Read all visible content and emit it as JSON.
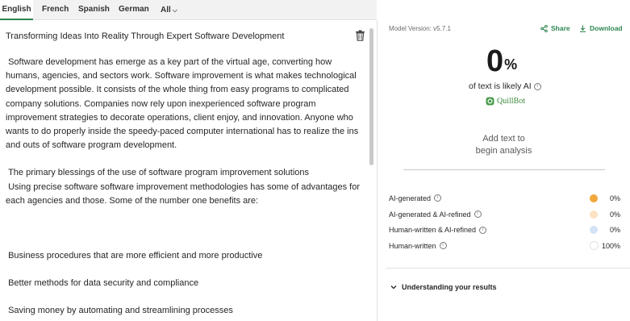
{
  "tabs": [
    "English",
    "French",
    "Spanish",
    "German",
    "All"
  ],
  "editor": {
    "title": "Transforming Ideas Into Reality Through Expert Software Development",
    "para1": " Software development has emerge as a key part of the virtual age, converting how humans, agencies, and sectors work. Software improvement is what makes technological development possible. It consists of the whole thing from easy programs to complicated company solutions. Companies now rely upon inexperienced software program improvement strategies to decorate operations, client enjoy, and innovation. Anyone who wants to do properly inside the speedy-paced computer international has to realize the ins and outs of software program development.",
    "para2": " The primary blessings of the use of software program improvement solutions",
    "para3": " Using precise software software improvement methodologies has some of advantages for each agencies and those. Some of the number one benefits are:",
    "item1": " Business procedures that are more efficient and more productive",
    "item2": " Better methods for data security and compliance",
    "item3": " Saving money by automating and streamlining processes"
  },
  "panel": {
    "model_version": "Model Version: v5.7.1",
    "share_label": "Share",
    "download_label": "Download",
    "score": "0",
    "score_unit": "%",
    "likely_label": "of text is likely AI",
    "brand": "QuillBot",
    "add_text_line1": "Add text to",
    "add_text_line2": "begin analysis",
    "rows": [
      {
        "label": "AI-generated",
        "pct": "0%",
        "color": "#f0a73c"
      },
      {
        "label": "AI-generated & AI-refined",
        "pct": "0%",
        "color": "#fbe2c2"
      },
      {
        "label": "Human-written & AI-refined",
        "pct": "0%",
        "color": "#d3e3f5"
      },
      {
        "label": "Human-written",
        "pct": "100%",
        "color": "#ffffff"
      }
    ],
    "understanding_label": "Understanding your results"
  },
  "colors": {
    "accent": "#2d8650"
  }
}
